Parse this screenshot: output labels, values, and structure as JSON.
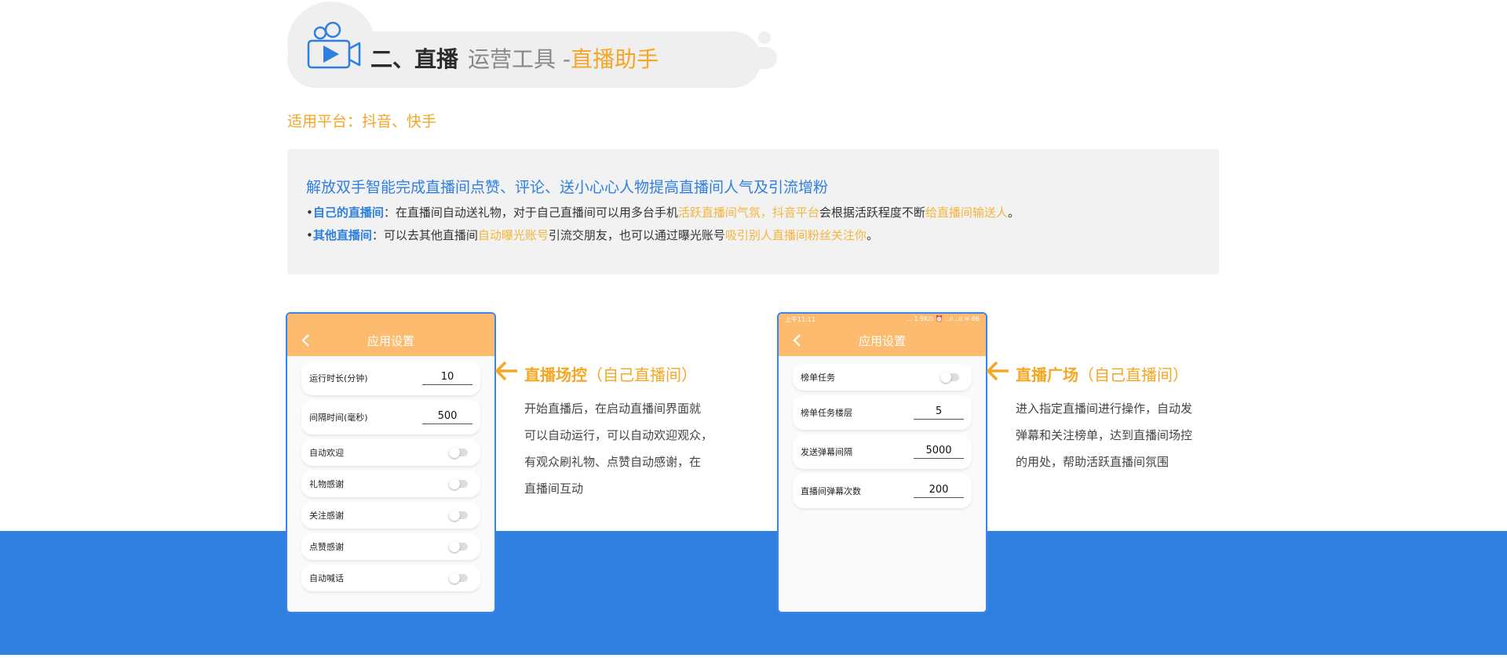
{
  "header": {
    "section": "二、直播",
    "category": "运营工具 -",
    "tool": "直播助手",
    "icon": "video-camera-icon"
  },
  "platform": "适用平台：抖音、快手",
  "info": {
    "title": "解放双手智能完成直播间点赞、评论、送小心心人物提高直播间人气及引流增粉",
    "line1": {
      "bullet": "•",
      "label": "自己的直播间",
      "t1": "：在直播间自动送礼物，对于自己直播间可以用多台手机",
      "h1": "活跃直播间气氛，抖音平台",
      "t2": "会根据活跃程度不断",
      "h2": "给直播间输送人",
      "t3": "。"
    },
    "line2": {
      "bullet": "•",
      "label": "其他直播间",
      "t1": "：可以去其他直播间",
      "h1": "自动曝光账号",
      "t2": "引流交朋友，也可以通过曝光账号",
      "h2": "吸引别人直播间粉丝关注你",
      "t3": "。"
    }
  },
  "phone1": {
    "title": "应用设置",
    "status_left": "",
    "status_right": "",
    "rows": [
      {
        "label": "运行时长(分钟)",
        "value": "10"
      },
      {
        "label": "间隔时间(毫秒)",
        "value": "500"
      }
    ],
    "toggles": [
      "自动欢迎",
      "礼物感谢",
      "关注感谢",
      "点赞感谢",
      "自动喊话"
    ]
  },
  "phone2": {
    "title": "应用设置",
    "status_left": "上午11:11",
    "status_right": "... 1.9K/s ⏰ ..ıl ..ıl ≋ 86",
    "toggle_row": "榜单任务",
    "rows": [
      {
        "label": "榜单任务楼层",
        "value": "5"
      },
      {
        "label": "发送弹幕间隔",
        "value": "5000"
      },
      {
        "label": "直播间弹幕次数",
        "value": "200"
      }
    ]
  },
  "desc1": {
    "title": "直播场控",
    "paren": "（自己直播间）",
    "lines": [
      "开始直播后，在启动直播间界面就",
      "可以自动运行，可以自动欢迎观众，",
      "有观众刷礼物、点赞自动感谢，在",
      "直播间互动"
    ]
  },
  "desc2": {
    "title": "直播广场",
    "paren": "（自己直播间）",
    "lines": [
      "进入指定直播间进行操作，自动发",
      "弹幕和关注榜单，达到直播间场控",
      "的用处，帮助活跃直播间氛围"
    ]
  },
  "colors": {
    "accent_orange": "#f5a623",
    "brand_blue": "#2f7fe0",
    "phone_header": "#fcbb6e"
  }
}
